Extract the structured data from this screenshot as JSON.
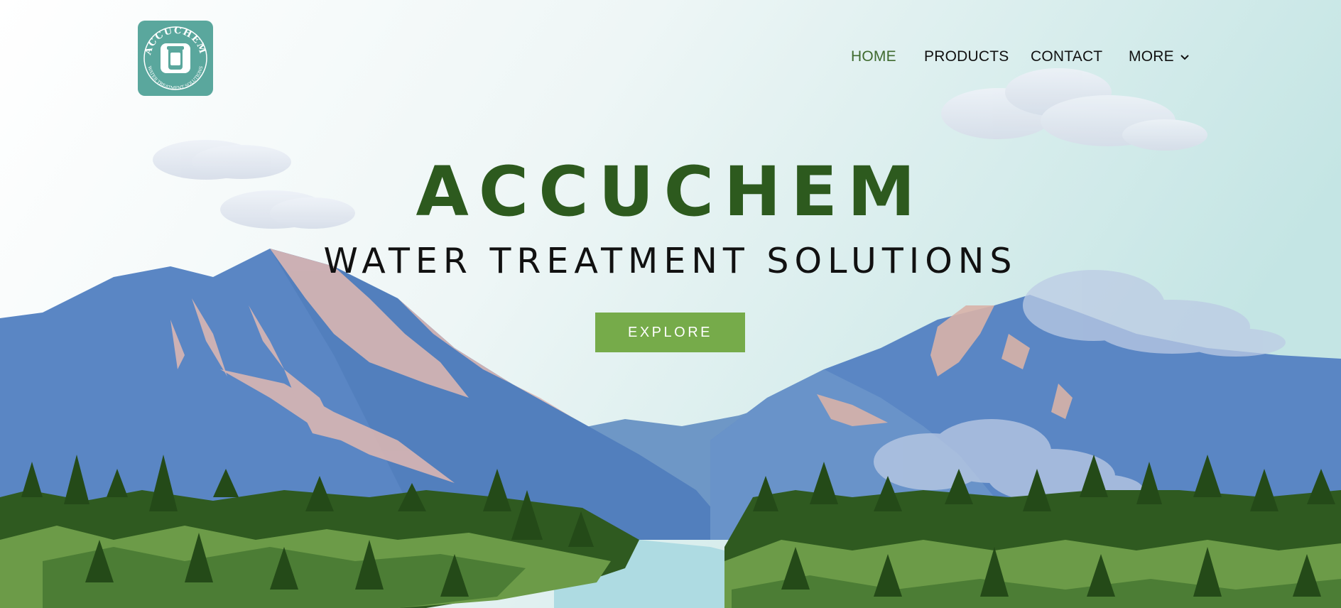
{
  "brand": {
    "logo_top_text": "ACCUCHEM",
    "logo_bottom_text": "WATER TREATMENT SOLUTIONS",
    "logo_color": "#5aa79d"
  },
  "nav": {
    "items": [
      {
        "label": "HOME",
        "active": true
      },
      {
        "label": "PRODUCTS",
        "active": false
      },
      {
        "label": "CONTACT",
        "active": false
      },
      {
        "label": "MORE",
        "active": false,
        "icon": "chevron-down-icon"
      }
    ],
    "active_color": "#3f6a2e"
  },
  "hero": {
    "title": "ACCUCHEM",
    "subtitle": "WATER TREATMENT SOLUTIONS",
    "cta_label": "EXPLORE",
    "title_color": "#2d5a1e",
    "cta_color": "#76ab4a"
  }
}
